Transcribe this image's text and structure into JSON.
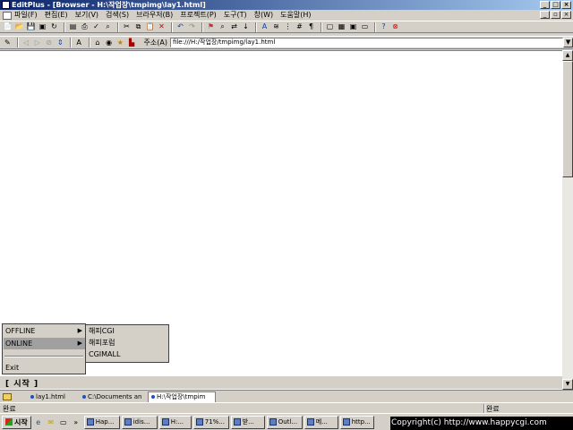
{
  "window": {
    "title": "EditPlus - [Browser - H:\\작업장\\tmpimg\\lay1.html]",
    "controls": [
      "_",
      "□",
      "×"
    ]
  },
  "menu": {
    "items": [
      "파일(F)",
      "편집(E)",
      "보기(V)",
      "검색(S)",
      "브라우저(B)",
      "프로젝트(P)",
      "도구(T)",
      "창(W)",
      "도움말(H)"
    ],
    "mdi_controls": [
      "_",
      "▫",
      "×"
    ]
  },
  "address": {
    "label": "주소(A)",
    "value": "file:///H:/작업장/tmpimg/lay1.html"
  },
  "page_menu": {
    "items": [
      {
        "label": "OFFLINE",
        "has_submenu": true,
        "selected": false
      },
      {
        "label": "ONLINE",
        "has_submenu": true,
        "selected": true
      },
      {
        "label": "Exit",
        "has_submenu": false,
        "selected": false
      }
    ],
    "submenu": [
      "해피CGI",
      "해피포럼",
      "CGIMALL"
    ],
    "start_label": "[ 시작 ]"
  },
  "doc_tabs": [
    {
      "label": "lay1.html",
      "active": false
    },
    {
      "label": "C:\\Documents an",
      "active": false
    },
    {
      "label": "H:\\작업장\\tmpim",
      "active": true
    }
  ],
  "status": {
    "left": "완료",
    "right": "완료"
  },
  "taskbar": {
    "start": "시작",
    "buttons": [
      "Hap...",
      "idis...",
      "H:...",
      "71%...",
      "받...",
      "Outl...",
      "메...",
      "http..."
    ],
    "overlay": "Copyright(c) http://www.happycgi.com"
  }
}
